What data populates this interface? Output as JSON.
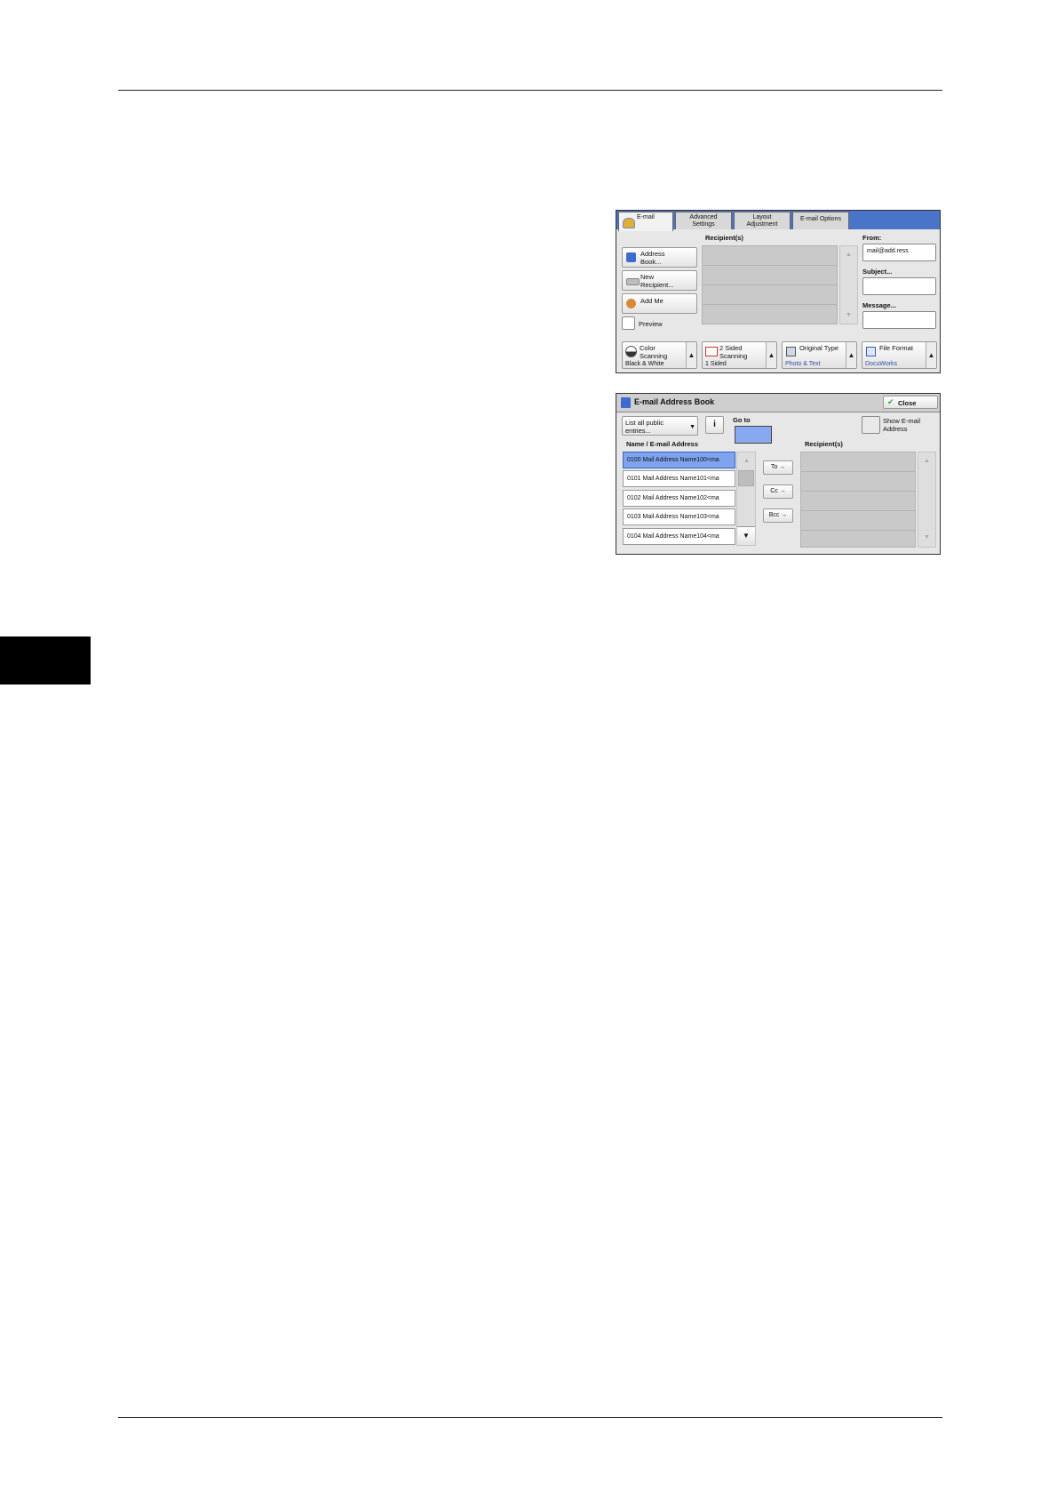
{
  "email_screen": {
    "tabs": [
      {
        "label": "E-mail"
      },
      {
        "label": "Advanced Settings"
      },
      {
        "label": "Layout Adjustment"
      },
      {
        "label": "E-mail Options"
      }
    ],
    "address_book": "Address Book...",
    "new_recipient": "New Recipient...",
    "add_me": "Add Me",
    "preview": "Preview",
    "recipients_header": "Recipient(s)",
    "from_label": "From:",
    "from_value": "mail@add.ress",
    "subject_label": "Subject...",
    "message_label": "Message...",
    "options": [
      {
        "title": "Color Scanning",
        "value": "Black & White"
      },
      {
        "title": "2 Sided Scanning",
        "value": "1 Sided"
      },
      {
        "title": "Original Type",
        "value": "Photo & Text"
      },
      {
        "title": "File Format",
        "value": "DocuWorks"
      }
    ]
  },
  "address_book_screen": {
    "title": "E-mail Address Book",
    "close": "Close",
    "list_filter": "List all public entries...",
    "go_to": "Go to",
    "show_email": "Show E-mail Address",
    "name_header": "Name / E-mail Address",
    "recipients_header": "Recipient(s)",
    "entries": [
      {
        "text": "0100  Mail Address Name100<ma"
      },
      {
        "text": "0101  Mail Address Name101<ma"
      },
      {
        "text": "0102  Mail Address Name102<ma"
      },
      {
        "text": "0103  Mail Address Name103<ma"
      },
      {
        "text": "0104  Mail Address Name104<ma"
      }
    ],
    "to": "To →",
    "cc": "Cc →",
    "bcc": "Bcc →"
  }
}
